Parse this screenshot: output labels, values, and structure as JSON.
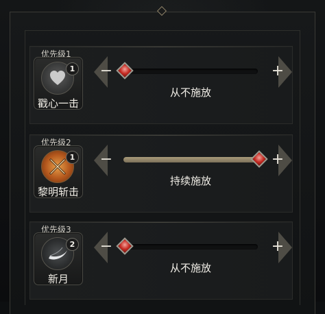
{
  "priorities": [
    {
      "priority_label": "优先级1",
      "skill": {
        "name": "戳心一击",
        "icon": "heart-icon",
        "badge": "1"
      },
      "slider_level": 0.0,
      "mode_text": "从不施放",
      "minus_label": "−",
      "plus_label": "+"
    },
    {
      "priority_label": "优先级2",
      "skill": {
        "name": "黎明斩击",
        "icon": "crossed-swords-icon",
        "badge": "1"
      },
      "slider_level": 1.0,
      "mode_text": "持续施放",
      "minus_label": "−",
      "plus_label": "+"
    },
    {
      "priority_label": "优先级3",
      "skill": {
        "name": "新月",
        "icon": "crescent-slash-icon",
        "badge": "2"
      },
      "slider_level": 0.0,
      "mode_text": "从不施放",
      "minus_label": "−",
      "plus_label": "+"
    }
  ],
  "colors": {
    "accent": "#c52a22",
    "slider_fill": "#a99b7a",
    "panel": "#1c1e1f"
  }
}
